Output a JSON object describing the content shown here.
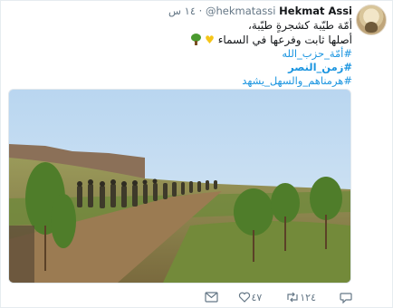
{
  "tweet": {
    "author_name": "Hekmat Assi",
    "author_handle": "@hekmatassi",
    "separator": "·",
    "time": "١٤ س",
    "text_line1": "أمّة طيّبة كشجرةٍ طيّبة،",
    "text_line2": "أصلها ثابت وفرعها في السماء",
    "hashtags": [
      "#أمّة_حزب_الله",
      "#زمن_النصر",
      "#هرمناهم_والسهل_يشهد"
    ],
    "icons": {
      "avatar": "profile-avatar",
      "tree_emoji": "deciduous-tree-emoji",
      "heart_emoji": "yellow-heart-emoji",
      "mail": "direct-message-icon",
      "like": "heart-outline-icon",
      "retweet": "retweet-icon",
      "reply": "reply-icon"
    }
  },
  "actions": {
    "likes": "٤٧",
    "retweets": "١٢٤"
  },
  "colors": {
    "link": "#1b95e0",
    "text": "#14171a",
    "muted": "#657786",
    "border": "#e6ecf0"
  }
}
